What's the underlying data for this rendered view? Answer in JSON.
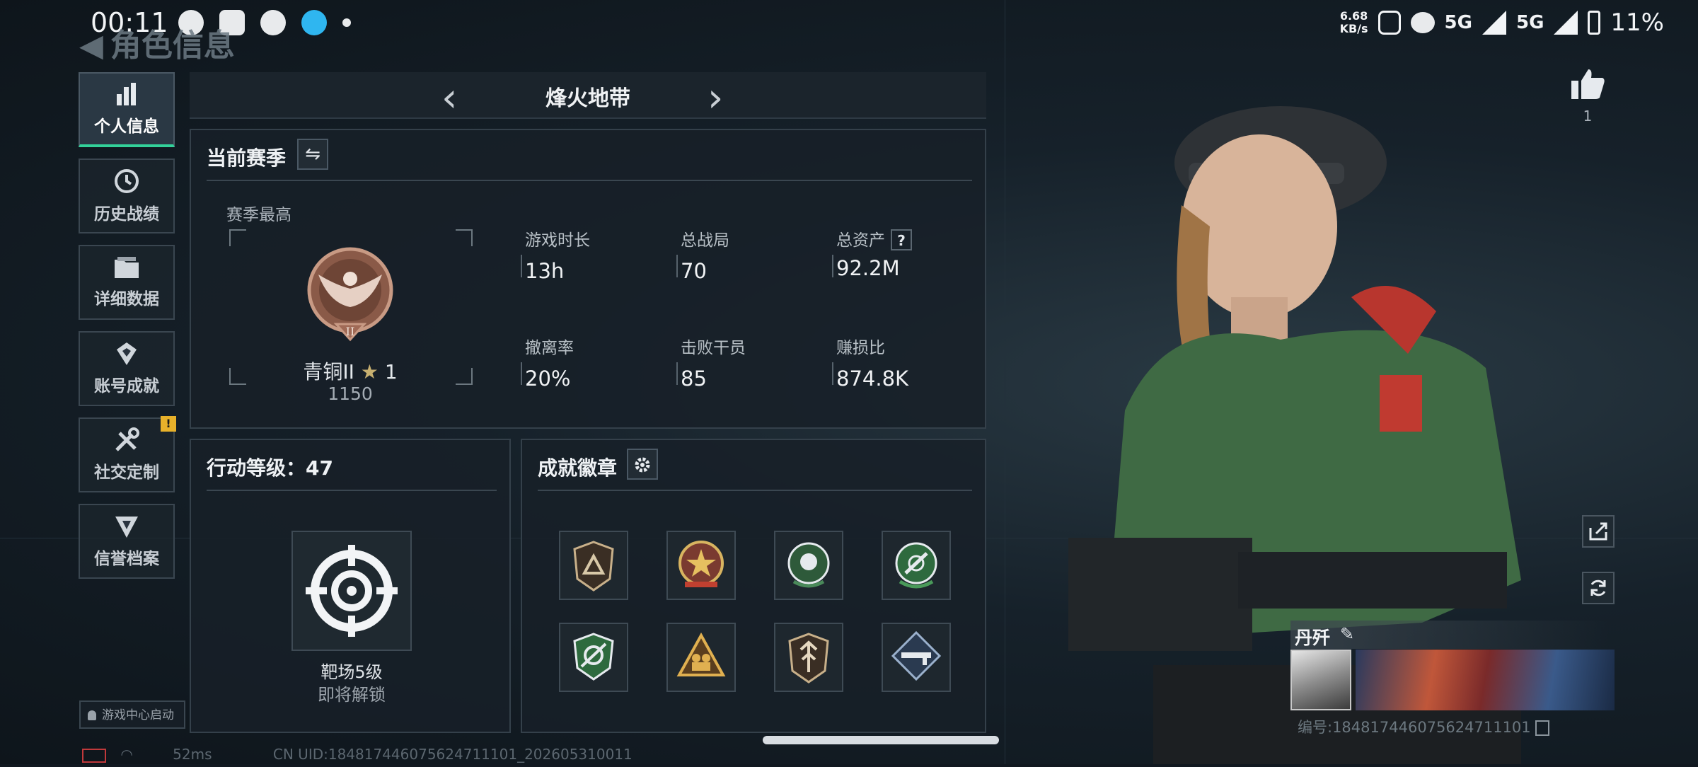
{
  "status_bar": {
    "time": "00:11",
    "net_speed_value": "6.68",
    "net_speed_unit": "KB/s",
    "network_1": "5G",
    "network_2": "5G",
    "battery": "11%"
  },
  "header": {
    "back_label": "角色信息"
  },
  "nav": {
    "items": [
      {
        "label": "个人信息",
        "icon": "bar-chart-icon",
        "active": true
      },
      {
        "label": "历史战绩",
        "icon": "history-icon"
      },
      {
        "label": "详细数据",
        "icon": "folder-icon"
      },
      {
        "label": "账号成就",
        "icon": "achievement-icon"
      },
      {
        "label": "社交定制",
        "icon": "tools-icon",
        "badge": "!"
      },
      {
        "label": "信誉档案",
        "icon": "credit-icon"
      }
    ]
  },
  "mode_tab": {
    "title": "烽火地带"
  },
  "season": {
    "title": "当前赛季",
    "best_label": "赛季最高",
    "rank_name": "青铜II",
    "rank_stars": "1",
    "rank_score": "1150",
    "medal_numeral": "II",
    "stats": [
      {
        "label": "游戏时长",
        "value": "13h"
      },
      {
        "label": "总战局",
        "value": "70"
      },
      {
        "label": "总资产",
        "value": "92.2M",
        "help": "?"
      },
      {
        "label": "撤离率",
        "value": "20%"
      },
      {
        "label": "击败干员",
        "value": "85"
      },
      {
        "label": "赚损比",
        "value": "874.8K"
      }
    ]
  },
  "action_level": {
    "title": "行动等级：47",
    "item_name": "靶场5级",
    "item_status": "即将解锁"
  },
  "achievements": {
    "title": "成就徽章",
    "badges": [
      {
        "icon": "triangle-shield-badge",
        "color": "#c8b08a"
      },
      {
        "icon": "star-emblem-badge",
        "color": "#d24a3a"
      },
      {
        "icon": "rose-green-badge",
        "color": "#4a8a5a"
      },
      {
        "icon": "green-crosshair-badge",
        "color": "#4a9a5a"
      },
      {
        "icon": "green-target-badge",
        "color": "#3a8a4a"
      },
      {
        "icon": "gold-team-badge",
        "color": "#c89a4a"
      },
      {
        "icon": "arrow-shield-badge",
        "color": "#c8b08a"
      },
      {
        "icon": "blue-rifle-badge",
        "color": "#6a8ab0"
      }
    ]
  },
  "footer": {
    "game_center": "游戏中心启动",
    "latency": "52ms",
    "uid_line": "CN UID:1848174460756247111­01_202605310011"
  },
  "profile": {
    "like_count": "1",
    "player_name": "丹歼",
    "player_id": "编号:1848174460756247111­01"
  }
}
